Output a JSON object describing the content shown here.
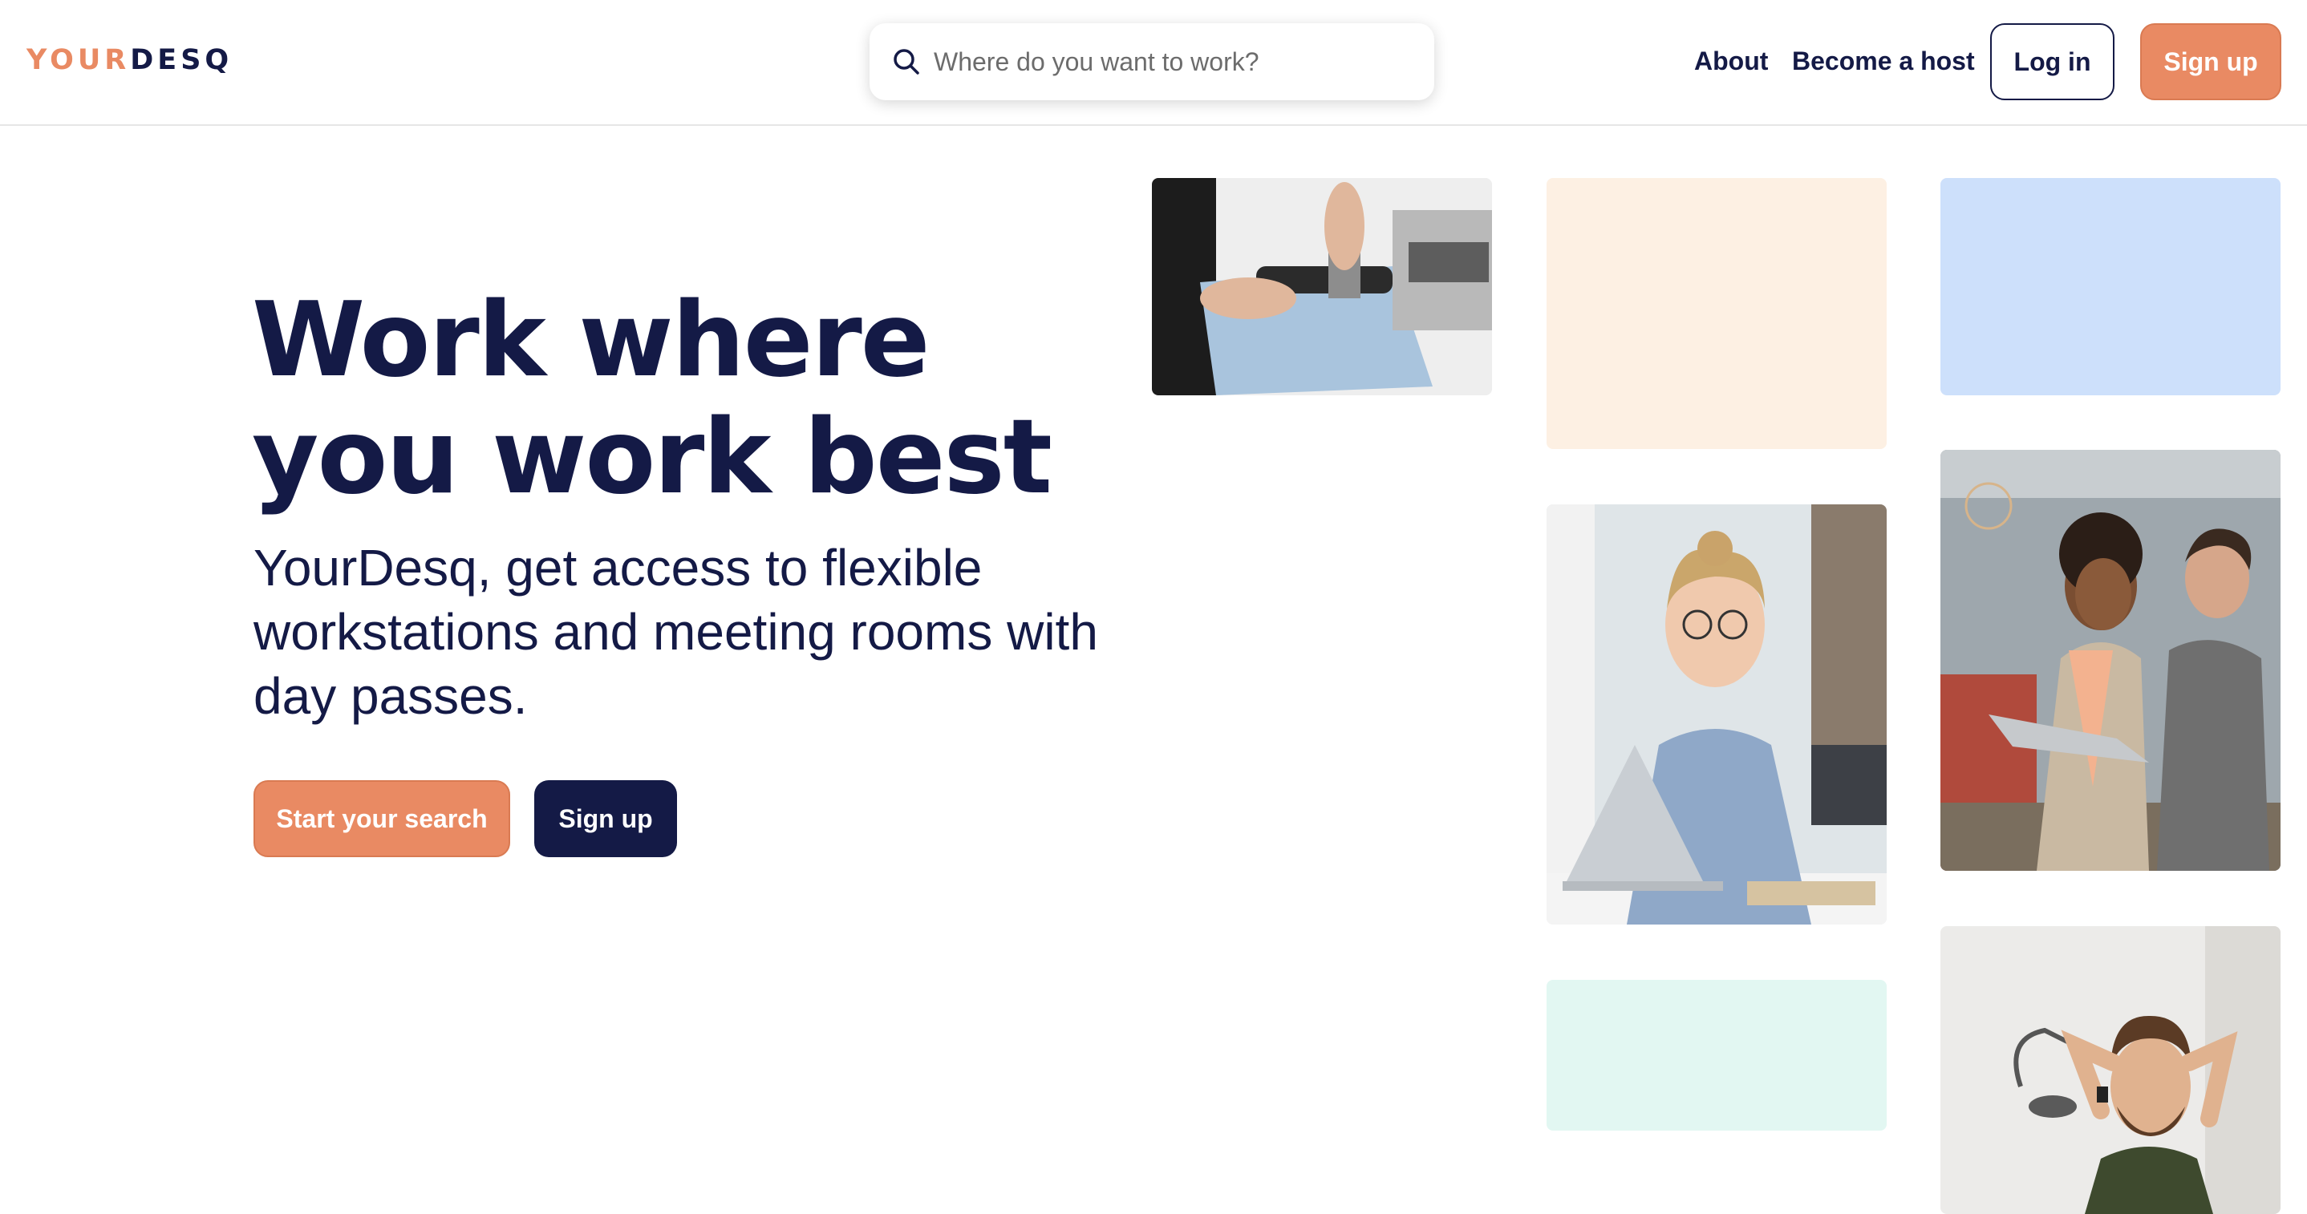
{
  "brand": {
    "logo_part1": "YOUR",
    "logo_part2": "DESQ"
  },
  "search": {
    "placeholder": "Where do you want to work?",
    "value": ""
  },
  "nav": {
    "about": "About",
    "become_host": "Become a host",
    "login": "Log in",
    "signup": "Sign up"
  },
  "hero": {
    "title": "Work where you work best",
    "subtitle": "YourDesq, get access to flexible workstations and meeting rooms with day passes.",
    "start_search": "Start your search",
    "signup": "Sign up"
  },
  "colors": {
    "brand_orange": "#e98a63",
    "brand_navy": "#141a46",
    "tile_peach": "#fdf0e3",
    "tile_blue": "#cde0fb",
    "tile_mint": "#e2f7f2"
  },
  "images": [
    {
      "name": "espresso-barista-photo"
    },
    {
      "name": "woman-at-laptop-photo"
    },
    {
      "name": "colleagues-with-laptop-photo"
    },
    {
      "name": "relaxed-man-photo"
    }
  ]
}
